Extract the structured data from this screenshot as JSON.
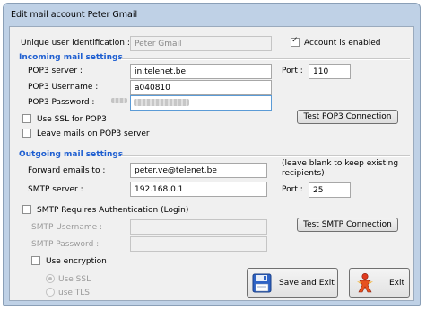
{
  "window": {
    "title": "Edit mail account Peter Gmail"
  },
  "identity": {
    "uid_label": "Unique user identification :",
    "uid_value": "Peter Gmail",
    "enabled_label": "Account is enabled",
    "enabled_checked": true
  },
  "incoming": {
    "header": "Incoming mail settings",
    "server_label": "POP3 server :",
    "server_value": "in.telenet.be",
    "port_label": "Port :",
    "port_value": "110",
    "username_label": "POP3 Username :",
    "username_value": "a040810",
    "password_label": "POP3 Password :",
    "ssl_label": "Use SSL for POP3",
    "ssl_checked": false,
    "leave_label": "Leave mails on POP3 server",
    "leave_checked": false,
    "test_button": "Test POP3 Connection"
  },
  "outgoing": {
    "header": "Outgoing mail settings",
    "forward_label": "Forward emails to :",
    "forward_value": "peter.ve@telenet.be",
    "forward_hint_line1": "(leave blank to keep existing",
    "forward_hint_line2": "recipients)",
    "smtp_label": "SMTP server :",
    "smtp_value": "192.168.0.1",
    "port_label": "Port :",
    "port_value": "25",
    "auth_label": "SMTP Requires Authentication (Login)",
    "auth_checked": false,
    "smtp_user_label": "SMTP Username :",
    "smtp_pass_label": "SMTP Password :",
    "test_button": "Test SMTP Connection",
    "encryption_label": "Use encryption",
    "encryption_checked": false,
    "ssl_option": "Use SSL",
    "tls_option": "use TLS"
  },
  "actions": {
    "save_label": "Save and Exit",
    "exit_label": "Exit"
  },
  "icons": {
    "save": "floppy-disk-icon",
    "exit": "exit-person-icon"
  },
  "colors": {
    "header": "#1f5fd1"
  }
}
